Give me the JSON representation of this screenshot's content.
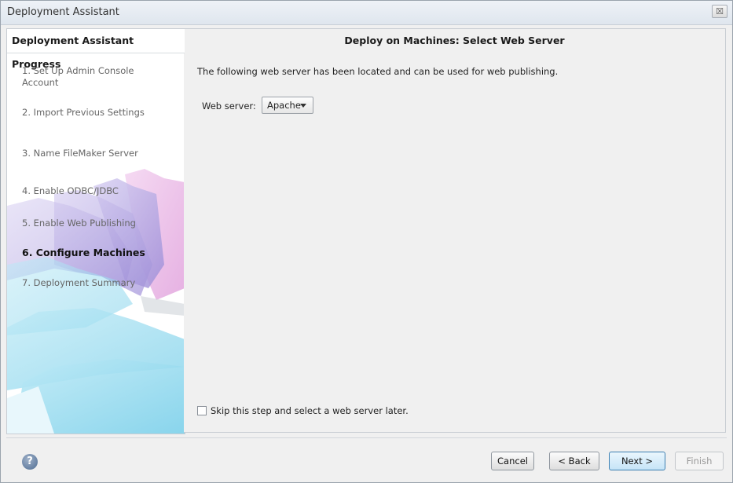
{
  "window": {
    "title": "Deployment Assistant",
    "close_glyph": "☒"
  },
  "sidebar": {
    "header": "Deployment Assistant Progress",
    "steps": [
      {
        "label": "1. Set Up Admin Console Account"
      },
      {
        "label": "2. Import Previous Settings"
      },
      {
        "label": "3. Name FileMaker Server"
      },
      {
        "label": "4. Enable ODBC/JDBC"
      },
      {
        "label": "5. Enable Web Publishing"
      },
      {
        "label": "6. Configure Machines",
        "active": true
      },
      {
        "label": "7. Deployment Summary"
      }
    ]
  },
  "main": {
    "header": "Deploy on Machines: Select Web Server",
    "intro": "The following web server has been located and can be used for web publishing.",
    "web_server_label": "Web server:",
    "web_server_value": "Apache",
    "skip_label": "Skip this step and select a web server later.",
    "skip_checked": false
  },
  "footer": {
    "help_glyph": "?",
    "cancel": "Cancel",
    "back": "< Back",
    "next": "Next >",
    "finish": "Finish"
  },
  "colors": {
    "accent_border": "#3c7fb1",
    "disabled_text": "#9a9a9a"
  },
  "icons": {
    "help": "help-icon",
    "close": "close-icon"
  }
}
